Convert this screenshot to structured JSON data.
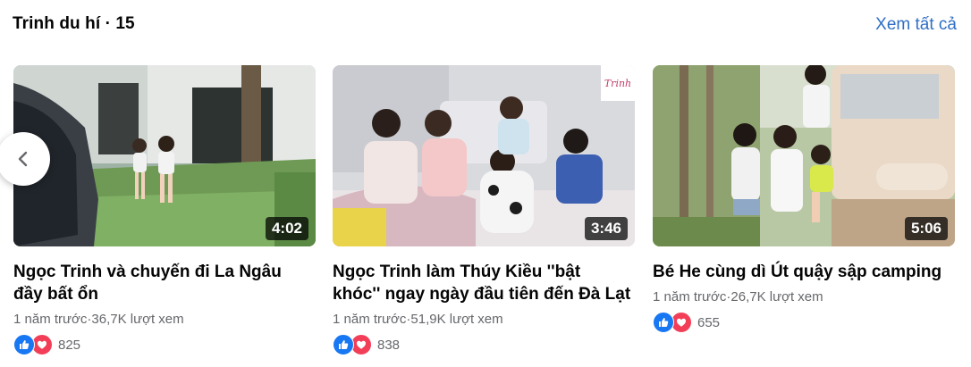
{
  "playlist": {
    "title": "Trinh du hí · 15",
    "see_all_label": "Xem tất cả"
  },
  "navigation": {
    "prev_icon": "chevron-left-icon"
  },
  "colors": {
    "link": "#2f6ec6",
    "like": "#1877f2",
    "love": "#f33e58",
    "meta": "#65676b"
  },
  "videos": [
    {
      "duration": "4:02",
      "title": "Ngọc Trinh và chuyến đi La Ngâu đầy bất ổn",
      "meta": "1 năm trước·36,7K lượt xem",
      "reaction_count": "825"
    },
    {
      "duration": "3:46",
      "title": "Ngọc Trinh làm Thúy Kiều ''bật khóc'' ngay ngày đầu tiên đến Đà Lạt",
      "meta": "1 năm trước·51,9K lượt xem",
      "reaction_count": "838"
    },
    {
      "duration": "5:06",
      "title": "Bé He cùng dì Út quậy sập camping",
      "meta": "1 năm trước·26,7K lượt xem",
      "reaction_count": "655"
    }
  ]
}
